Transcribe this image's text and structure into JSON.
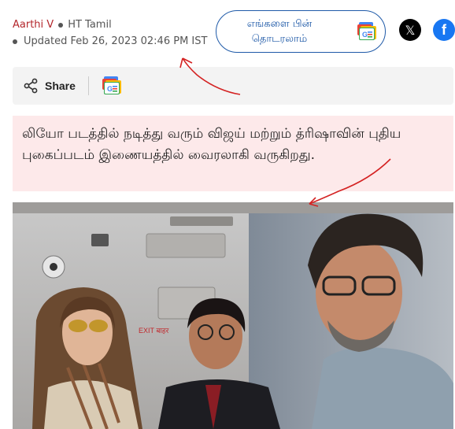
{
  "byline": {
    "author": "Aarthi V",
    "source": "HT Tamil",
    "updated": "Updated Feb 26, 2023 02:46 PM IST"
  },
  "follow": {
    "label": "எங்களை பின்\nதொடரலாம்"
  },
  "social": {
    "x_glyph": "𝕏",
    "fb_glyph": "f"
  },
  "share": {
    "label": "Share"
  },
  "summary": {
    "text": "லியோ படத்தில் நடித்து வரும் விஜய் மற்றும் த்ரிஷாவின் புதிய புகைப்படம் இணையத்தில் வைரலாகி வருகிறது."
  },
  "photo": {
    "exit_sign": "EXIT बाहर"
  },
  "colors": {
    "author": "#b3262b",
    "accent": "#1f5aa8",
    "summary_bg": "#fde9ea",
    "annotation": "#d42222"
  }
}
